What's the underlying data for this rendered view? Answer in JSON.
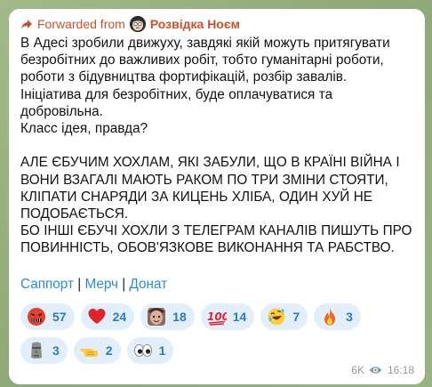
{
  "forward": {
    "prefix": "Forwarded from",
    "channel": "Розвідка Ноєм"
  },
  "message": {
    "text": "В Адесі зробили движуху, завдякі якій можуть притягувати безробітних до важливих робіт, тобто гуманітарні роботи, роботи з бідувництва фортифікацій, розбір завалів.\nІніціатива для безробітних, буде оплачуватися та добровільна.\nКласс ідея, правда?\n\nАЛЕ ЄБУЧИМ ХОХЛАМ, ЯКІ ЗАБУЛИ, ЩО В КРАЇНІ ВІЙНА І ВОНИ ВЗАГАЛІ МАЮТЬ РАКОМ ПО ТРИ ЗМІНИ СТОЯТИ, КЛІПАТИ СНАРЯДИ ЗА КИЦЕНЬ ХЛІБА, ОДИН ХУЙ НЕ ПОДОБАЄТЬСЯ.\nБО ІНШІ ЄБУЧІ ХОХЛИ З ТЕЛЕГРАМ КАНАЛІВ ПИШУТЬ ПРО ПОВИННІСТЬ, ОБОВ'ЯЗКОВЕ ВИКОНАННЯ ТА РАБСТВО."
  },
  "links": {
    "support": "Саппорт",
    "merch": "Мерч",
    "donate": "Донат",
    "separator": "|"
  },
  "reactions": [
    {
      "icon": "angry-face-icon",
      "count": "57"
    },
    {
      "icon": "red-heart-icon",
      "count": "24"
    },
    {
      "icon": "custom-sticker-icon",
      "count": "18"
    },
    {
      "icon": "hundred-points-icon",
      "count": "14"
    },
    {
      "icon": "rofl-face-icon",
      "count": "7"
    },
    {
      "icon": "fire-icon",
      "count": "3"
    },
    {
      "icon": "moai-icon",
      "count": "3"
    },
    {
      "icon": "pointing-hand-icon",
      "count": "2"
    },
    {
      "icon": "eyes-icon",
      "count": "1"
    }
  ],
  "meta": {
    "views": "6K",
    "time": "16:18"
  },
  "colors": {
    "forward": "#c8532a",
    "link": "#2e8ad6",
    "reaction_bg": "#e2eef9",
    "reaction_text": "#2b7bc2"
  }
}
